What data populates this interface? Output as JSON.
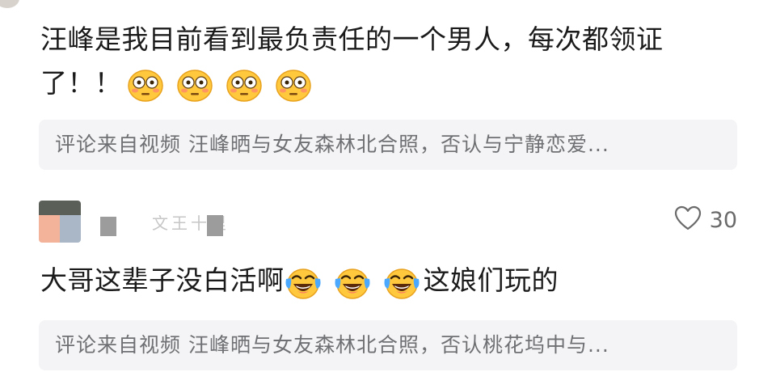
{
  "comment1": {
    "line1": "汪峰是我目前看到最负责任的一个男人，每次都领证",
    "line2": "了！！",
    "emojis": [
      "flushed-emoji-icon",
      "flushed-emoji-icon",
      "flushed-emoji-icon",
      "flushed-emoji-icon"
    ],
    "source": "评论来自视频 汪峰晒与女友森林北合照，否认与宁静恋爱..."
  },
  "comment2": {
    "author_fragment": "文王十里",
    "likes": "30",
    "text_before": "大哥这辈子没白活啊",
    "emojis": [
      "laughing-crying-emoji-icon",
      "laughing-crying-emoji-icon",
      "laughing-crying-emoji-icon"
    ],
    "text_after": "这娘们玩的",
    "source": "评论来自视频 汪峰晒与女友森林北合照，否认桃花坞中与..."
  },
  "colors": {
    "source_bg": "#f4f4f6",
    "source_text": "#6f7073",
    "emoji_yellow": "#ffc83d"
  }
}
